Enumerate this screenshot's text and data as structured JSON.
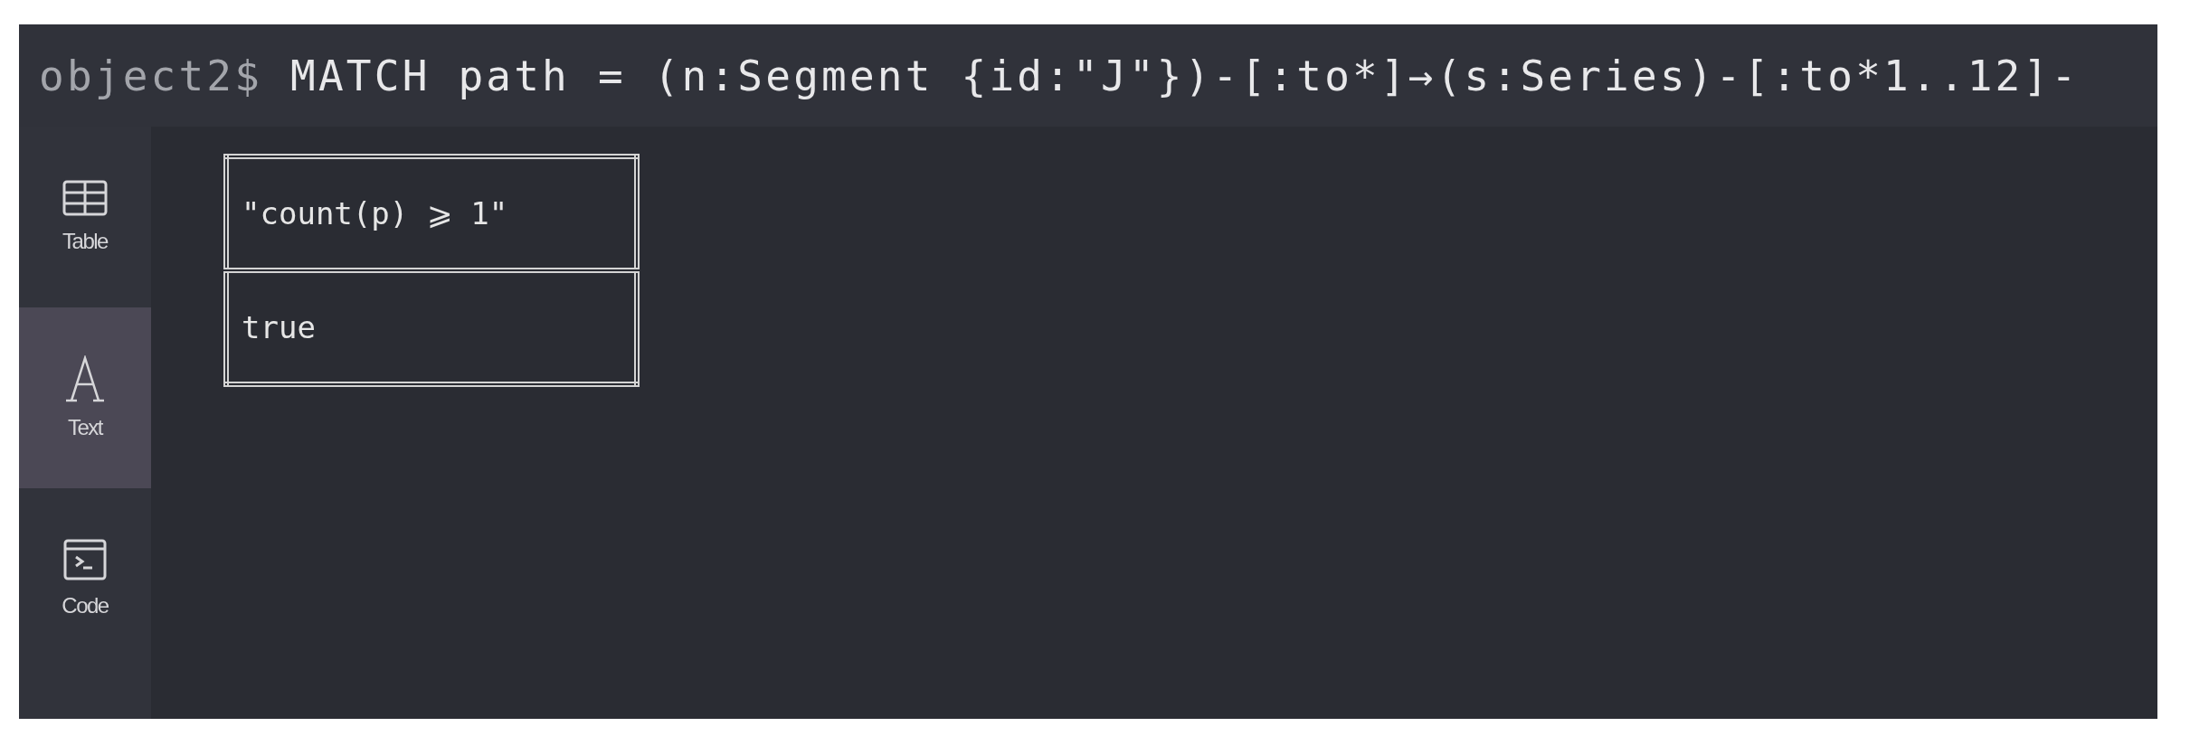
{
  "command": {
    "prompt": "object2$",
    "query": "MATCH path = (n:Segment {id:\"J\"})-[:to*]→(s:Series)-[:to*1..12]-"
  },
  "sidebar": {
    "items": [
      {
        "kind": "table",
        "label": "Table",
        "selected": false
      },
      {
        "kind": "text",
        "label": "Text",
        "selected": true
      },
      {
        "kind": "code",
        "label": "Code",
        "selected": false
      }
    ]
  },
  "result_table": {
    "columns": [
      "\"count(p) ⩾ 1\""
    ],
    "rows": [
      [
        "true"
      ]
    ]
  }
}
